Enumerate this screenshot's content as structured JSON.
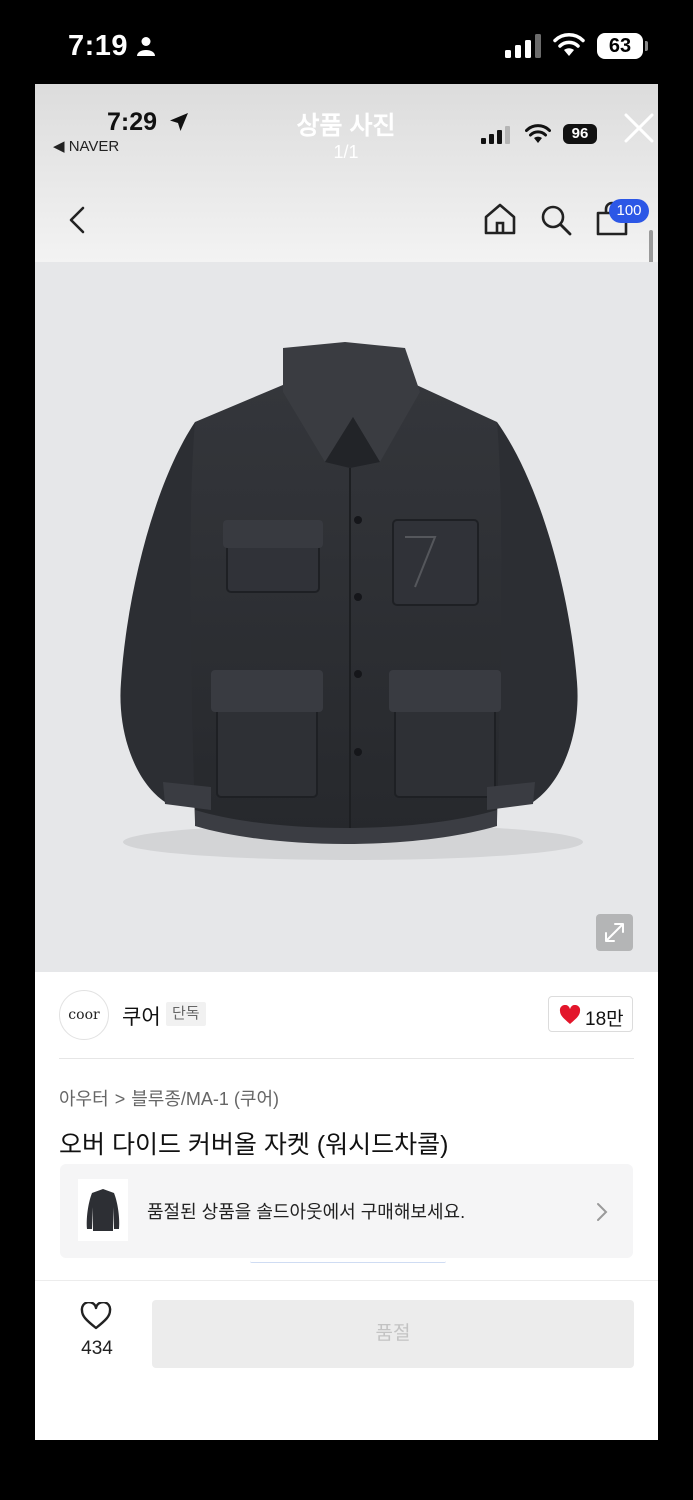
{
  "outer_status": {
    "time": "7:19",
    "battery": "63"
  },
  "viewer": {
    "title": "상품 사진",
    "counter": "1/1"
  },
  "inner_status": {
    "time": "7:29",
    "back_app": "◀ NAVER",
    "battery": "96"
  },
  "nav": {
    "cart_count": "100"
  },
  "brand": {
    "logo_text": "coor",
    "name": "쿠어",
    "tag": "단독",
    "like_count": "18만"
  },
  "breadcrumb": {
    "category": "아우터",
    "separator": ">",
    "subcategory": "블루종/MA-1 (쿠어)"
  },
  "product": {
    "title": "오버 다이드 커버올 자켓 (워시드차콜)"
  },
  "sold_banner": {
    "text": "품절된 상품을 솔드아웃에서 구매해보세요."
  },
  "bottom": {
    "wish_count": "434",
    "button_label": "품절"
  },
  "colors": {
    "badge": "#2c57e6",
    "heart": "#e3162b",
    "photo_bg": "#e6e7e9",
    "jacket": "#2f3136"
  },
  "icons": [
    "person-icon",
    "signal-icon",
    "wifi-icon",
    "battery-icon",
    "location-arrow-icon",
    "close-icon",
    "back-chevron-icon",
    "home-icon",
    "search-icon",
    "shopping-bag-icon",
    "expand-icon",
    "heart-filled-icon",
    "chevron-right-icon",
    "heart-outline-icon"
  ]
}
